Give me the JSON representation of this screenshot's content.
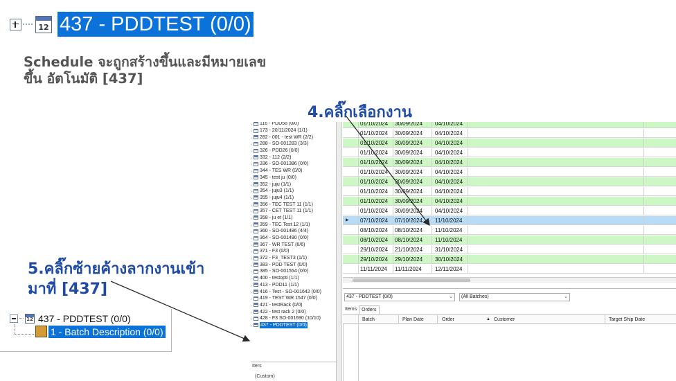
{
  "top_node": {
    "calendar_number": "12",
    "label": "437 - PDDTEST (0/0)"
  },
  "note": {
    "line1": "Schedule จะถูกสร้างขึ้นและมีหมายเลข",
    "line2": "ขึ้น อัตโนมัติ [437]"
  },
  "step4": {
    "text": "4.คลิ๊กเลือกงาน"
  },
  "step5": {
    "line1": "5.คลิ๊กซ้ายค้างลากงานเข้า",
    "line2": "มาที่ [437]"
  },
  "zoom_left": {
    "parent_label": "437 - PDDTEST (0/0)",
    "child_label": "1 - Batch Description (0/0)"
  },
  "tree": {
    "items": [
      "116 - PDD58 (0/0)",
      "173 - 20/11/2024 (1/1)",
      "282 - 001 - test WR (2/2)",
      "288 - SO-001283 (3/3)",
      "326 - PDD26 (0/0)",
      "332 - 112 (2/2)",
      "336 - SO-001386 (0/0)",
      "344 - TES WR (0/0)",
      "345 - test ju (0/0)",
      "352 - juju (1/1)",
      "354 - juju3 (1/1)",
      "355 - juju4 (1/1)",
      "356 - TEC TEST 11 (1/1)",
      "357 - CET TEST 11 (1/1)",
      "358 - ju et (1/1)",
      "359 - TEC Test 12 (1/1)",
      "360 - SO-001486 (4/4)",
      "364 - SO-001490 (0/0)",
      "367 - WR TEST (6/6)",
      "371 - F3 (0/0)",
      "372 - F3_TEST3 (1/1)",
      "383 - PDD TEST (0/0)",
      "385 - SO-001554 (0/0)",
      "400 - testopti (1/1)",
      "413 - PDD11 (1/1)",
      "416 - Test - SO-001642 (0/0)",
      "419 - TEST WR 1547 (0/0)",
      "421 - testRack (0/0)",
      "422 - test rack 2 (0/0)",
      "428 - F3 SO-001690 (10/10)",
      "437 - PDDTEST (0/0)"
    ],
    "selected_index": 30
  },
  "items_panel": {
    "header": "Iters",
    "value": "(Custom)"
  },
  "grid": {
    "rows": [
      {
        "c1": "01/10/2024",
        "c2": "30/09/2024",
        "c3": "04/10/2024",
        "color": "green"
      },
      {
        "c1": "01/10/2024",
        "c2": "30/09/2024",
        "c3": "04/10/2024",
        "color": "white"
      },
      {
        "c1": "01/10/2024",
        "c2": "30/09/2024",
        "c3": "04/10/2024",
        "color": "green"
      },
      {
        "c1": "01/10/2024",
        "c2": "30/09/2024",
        "c3": "04/10/2024",
        "color": "white"
      },
      {
        "c1": "01/10/2024",
        "c2": "30/09/2024",
        "c3": "04/10/2024",
        "color": "green"
      },
      {
        "c1": "01/10/2024",
        "c2": "30/09/2024",
        "c3": "04/10/2024",
        "color": "white"
      },
      {
        "c1": "01/10/2024",
        "c2": "30/09/2024",
        "c3": "04/10/2024",
        "color": "green"
      },
      {
        "c1": "01/10/2024",
        "c2": "30/09/2024",
        "c3": "04/10/2024",
        "color": "white"
      },
      {
        "c1": "01/10/2024",
        "c2": "30/09/2024",
        "c3": "04/10/2024",
        "color": "green"
      },
      {
        "c1": "01/10/2024",
        "c2": "30/09/2024",
        "c3": "04/10/2024",
        "color": "white"
      },
      {
        "c1": "07/10/2024",
        "c2": "07/10/2024",
        "c3": "11/10/2024",
        "color": "blue",
        "mark": "▶"
      },
      {
        "c1": "08/10/2024",
        "c2": "08/10/2024",
        "c3": "11/10/2024",
        "color": "white"
      },
      {
        "c1": "08/10/2024",
        "c2": "08/10/2024",
        "c3": "11/10/2024",
        "color": "green"
      },
      {
        "c1": "29/10/2024",
        "c2": "21/10/2024",
        "c3": "31/10/2024",
        "color": "white"
      },
      {
        "c1": "29/10/2024",
        "c2": "29/10/2024",
        "c3": "30/10/2024",
        "color": "green"
      },
      {
        "c1": "11/11/2024",
        "c2": "11/11/2024",
        "c3": "12/11/2024",
        "color": "white"
      }
    ],
    "row_colors": {
      "green": "#cdf7c5",
      "white": "#ffffff",
      "blue": "#b9dcf6"
    }
  },
  "lower": {
    "schedule_select": "437 - PDDTEST (0/0)",
    "batch_select": "(All Batches)",
    "tabs": [
      "Items",
      "Orders"
    ],
    "columns": [
      "Batch",
      "Plan Date",
      "Order",
      "Customer",
      "Target Ship Date"
    ]
  },
  "colors": {
    "selection": "#0a72d8",
    "callout": "#1f4aa5",
    "note": "#545454"
  }
}
